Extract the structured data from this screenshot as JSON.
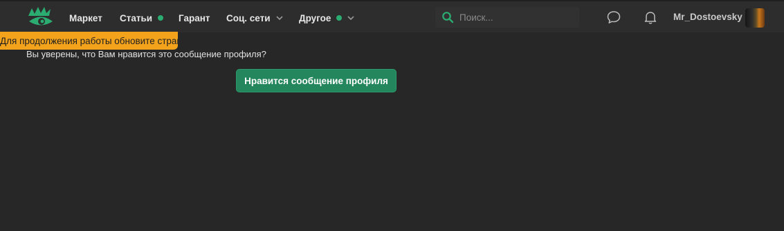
{
  "header": {
    "logo_icon": "eye-logo-icon",
    "nav": [
      {
        "label": "Маркет",
        "dot": false,
        "dropdown": false
      },
      {
        "label": "Статьи",
        "dot": true,
        "dropdown": false
      },
      {
        "label": "Гарант",
        "dot": false,
        "dropdown": false
      },
      {
        "label": "Соц. сети",
        "dot": false,
        "dropdown": true
      },
      {
        "label": "Другое",
        "dot": true,
        "dropdown": true
      }
    ],
    "search": {
      "placeholder": "Поиск...",
      "value": "",
      "icon": "search-icon"
    },
    "messages_icon": "chat-bubble-icon",
    "notifications_icon": "bell-icon",
    "username": "Mr_Dostoevsky"
  },
  "notice": {
    "text": "Для продолжения работы обновите страницу."
  },
  "main": {
    "question": "Вы уверены, что Вам нравится это сообщение профиля?",
    "confirm_label": "Нравится сообщение профиля"
  },
  "colors": {
    "background": "#272727",
    "navbar": "#2d2d2d",
    "accent_green": "#2bad72",
    "button_green": "#23865c",
    "notice_orange": "#f3a21c"
  }
}
